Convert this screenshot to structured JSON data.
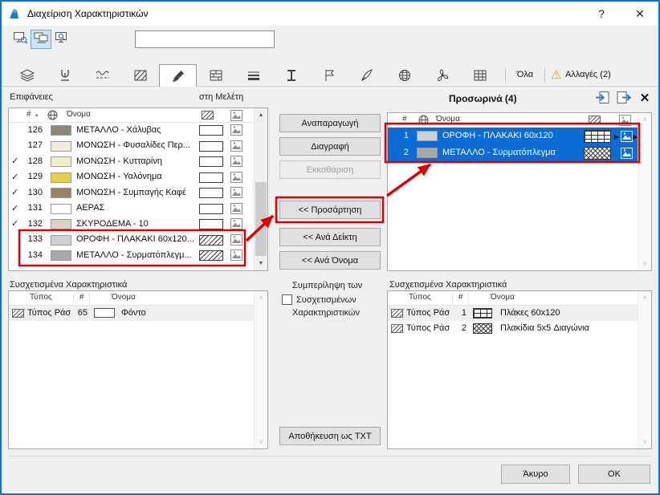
{
  "window": {
    "title": "Διαχείριση Χαρακτηριστικών",
    "help_label": "?",
    "close_label": "✕"
  },
  "toolbar": {
    "search_value": ""
  },
  "tabs": {
    "selected_index": 4,
    "items": [
      {
        "id": "layers",
        "icon": "layers-icon"
      },
      {
        "id": "pens",
        "icon": "pen-icon"
      },
      {
        "id": "linetypes",
        "icon": "linetype-icon"
      },
      {
        "id": "fills",
        "icon": "fill-hatch-icon"
      },
      {
        "id": "surfaces",
        "icon": "paintbrush-icon"
      },
      {
        "id": "composites",
        "icon": "composite-icon"
      },
      {
        "id": "lineweights",
        "icon": "lineweight-icon"
      },
      {
        "id": "profiles",
        "icon": "ibeam-icon"
      },
      {
        "id": "zones",
        "icon": "zone-flag-icon"
      },
      {
        "id": "markup",
        "icon": "quill-icon"
      },
      {
        "id": "cities",
        "icon": "globe-icon"
      },
      {
        "id": "operation-profiles",
        "icon": "fan-icon"
      },
      {
        "id": "mep",
        "icon": "grid-icon"
      }
    ],
    "all_label": "Όλα",
    "changes_label": "Αλλαγές (2)"
  },
  "left_panel": {
    "title": "Επιφάνειες",
    "scope_label": "στη Μελέτη",
    "columns": {
      "index": "#",
      "name": "Όνομα"
    },
    "rows": [
      {
        "checked": false,
        "num": "126",
        "color": "#8e887b",
        "name": "ΜΕΤΑΛΛΟ - Χάλυβας",
        "hatch": false
      },
      {
        "checked": false,
        "num": "127",
        "color": "#f2ecdd",
        "name": "ΜΟΝΩΣΗ - Φυσαλίδες Περ...",
        "hatch": false
      },
      {
        "checked": true,
        "num": "128",
        "color": "#f1edca",
        "name": "ΜΟΝΩΣΗ - Κυτταρίνη",
        "hatch": false
      },
      {
        "checked": true,
        "num": "129",
        "color": "#e6d14f",
        "name": "ΜΟΝΩΣΗ - Υαλόνημα",
        "hatch": false
      },
      {
        "checked": true,
        "num": "130",
        "color": "#9b8164",
        "name": "ΜΟΝΩΣΗ - Συμπαγής Καφέ",
        "hatch": false
      },
      {
        "checked": true,
        "num": "131",
        "color": "#ffffff",
        "name": "ΑΕΡΑΣ",
        "hatch": false
      },
      {
        "checked": true,
        "num": "132",
        "color": "#d8d3ca",
        "name": "ΣΚΥΡΟΔΕΜΑ - 10",
        "hatch": false
      },
      {
        "checked": false,
        "num": "133",
        "color": "#cbd1d5",
        "name": "ΟΡΟΦΗ - ΠΛΑΚΑΚΙ 60x120...",
        "hatch": true
      },
      {
        "checked": false,
        "num": "134",
        "color": "#a8a8a8",
        "name": "ΜΕΤΑΛΛΟ - Συρματόπλεγμ...",
        "hatch": true
      }
    ]
  },
  "middle": {
    "buttons": [
      {
        "name": "duplicate-button",
        "label": "Αναπαραγωγή",
        "enabled": true
      },
      {
        "name": "delete-button",
        "label": "Διαγραφή",
        "enabled": true
      },
      {
        "name": "purge-button",
        "label": "Εκκαθάριση",
        "enabled": false
      },
      {
        "name": "append-button",
        "label": "<< Προσάρτηση",
        "enabled": true
      },
      {
        "name": "by-index-button",
        "label": "<< Ανά Δείκτη",
        "enabled": true
      },
      {
        "name": "by-name-button",
        "label": "<< Ανά Όνομα",
        "enabled": true
      }
    ],
    "include_lines": [
      "Συμπερίληψη των",
      "Συσχετισμένων",
      "Χαρακτηριστικών"
    ],
    "include_checked": false,
    "save_txt_label": "Αποθήκευση ως TXT"
  },
  "right_panel": {
    "title": "Προσωρινά (4)",
    "columns": {
      "index": "#",
      "name": "Όνομα"
    },
    "rows": [
      {
        "num": "1",
        "name": "ΟΡΟΦΗ - ΠΛΑΚΑΚΙ 60x120",
        "color": "#cbd1d5",
        "pattern": "grid",
        "selected": true,
        "arrows": true
      },
      {
        "num": "2",
        "name": "ΜΕΤΑΛΛΟ - Συρματόπλεγμα",
        "color": "#a8a8a8",
        "pattern": "cross",
        "selected": true,
        "arrows": false
      }
    ]
  },
  "left_assoc": {
    "title": "Συσχετισμένα Χαρακτηριστικά",
    "columns": {
      "type": "Τύπος",
      "index": "#",
      "name": "Όνομα"
    },
    "rows": [
      {
        "type": "Τύπος Ράσ",
        "num": "65",
        "swatch": "#ffffff",
        "name": "Φόντο"
      }
    ]
  },
  "right_assoc": {
    "title": "Συσχετισμένα Χαρακτηριστικά",
    "columns": {
      "type": "Τύπος",
      "index": "#",
      "name": "Όνομα"
    },
    "rows": [
      {
        "type": "Τύπος Ράσ",
        "num": "1",
        "pattern": "grid",
        "name": "Πλάκες 60x120"
      },
      {
        "type": "Τύπος Ράσ",
        "num": "2",
        "pattern": "cross",
        "name": "Πλακίδια 5x5 Διαγώνια"
      }
    ]
  },
  "footer": {
    "cancel_label": "Άκυρο",
    "ok_label": "OK"
  },
  "annotations": {
    "color": "#e00000"
  }
}
